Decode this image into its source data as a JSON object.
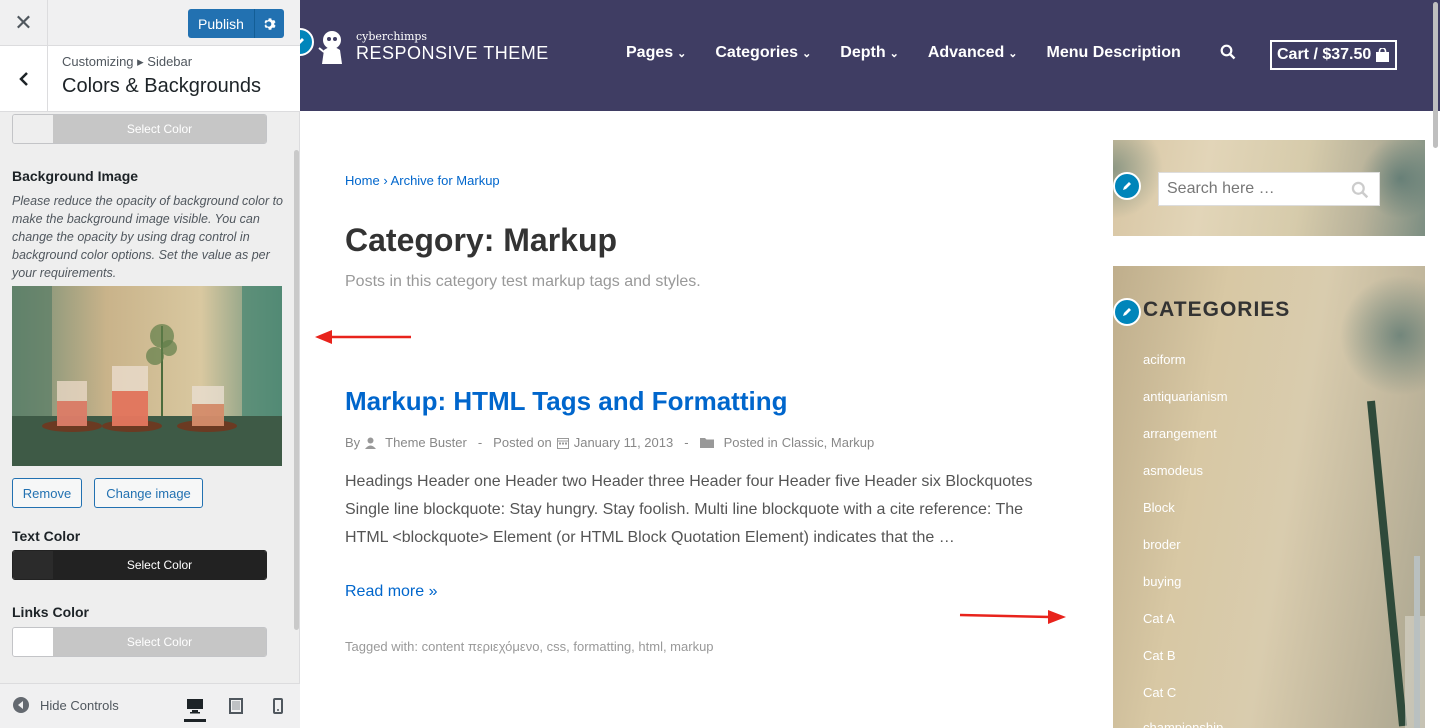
{
  "customizer": {
    "close_icon": "close-icon",
    "publish_label": "Publish",
    "breadcrumb": "Customizing ▸ Sidebar",
    "section_title": "Colors & Backgrounds",
    "select_color_label": "Select Color",
    "background_image": {
      "label": "Background Image",
      "description": "Please reduce the opacity of background color to make the background image visible. You can change the opacity by using drag control in background color options. Set the value as per your requirements.",
      "remove_label": "Remove",
      "change_label": "Change image"
    },
    "text_color": {
      "label": "Text Color",
      "button": "Select Color",
      "swatch": "#222222"
    },
    "links_color": {
      "label": "Links Color",
      "button": "Select Color",
      "swatch": "#ffffff"
    },
    "top_color": {
      "button": "Select Color",
      "swatch": "#eeeeee"
    },
    "hide_controls_label": "Hide Controls",
    "devices": [
      "desktop-icon",
      "tablet-icon",
      "mobile-icon"
    ]
  },
  "site": {
    "brand_small": "cyberchimps",
    "brand_big": "RESPONSIVE THEME",
    "nav": [
      {
        "label": "Pages",
        "dropdown": true
      },
      {
        "label": "Categories",
        "dropdown": true
      },
      {
        "label": "Depth",
        "dropdown": true
      },
      {
        "label": "Advanced",
        "dropdown": true
      },
      {
        "label": "Menu Description",
        "dropdown": false
      }
    ],
    "cart_label": "Cart / $37.50",
    "header_color": "#3f3d63",
    "accent_color": "#0066cc"
  },
  "archive": {
    "breadcrumb_home": "Home",
    "breadcrumb_sep": "›",
    "breadcrumb_current": "Archive for Markup",
    "title": "Category: Markup",
    "subtitle": "Posts in this category test markup tags and styles."
  },
  "post": {
    "title": "Markup: HTML Tags and Formatting",
    "by": "By",
    "author": "Theme Buster",
    "sep": "-",
    "posted_on": "Posted on",
    "date": "January 11, 2013",
    "posted_in": "Posted in",
    "cat1": "Classic",
    "cat_sep": ",",
    "cat2": "Markup",
    "excerpt": "Headings Header one Header two Header three Header four Header five Header six Blockquotes Single line blockquote: Stay hungry. Stay foolish. Multi line blockquote with a cite reference: The HTML <blockquote> Element (or HTML Block Quotation Element) indicates that the …",
    "read_more": "Read more »",
    "tags": "Tagged with: content περιεχόμενο, css, formatting, html, markup"
  },
  "sidebar": {
    "search_placeholder": "Search here …",
    "categories_title": "CATEGORIES",
    "categories": [
      "aciform",
      "antiquarianism",
      "arrangement",
      "asmodeus",
      "Block",
      "broder",
      "buying",
      "Cat A",
      "Cat B",
      "Cat C",
      "championship"
    ]
  }
}
